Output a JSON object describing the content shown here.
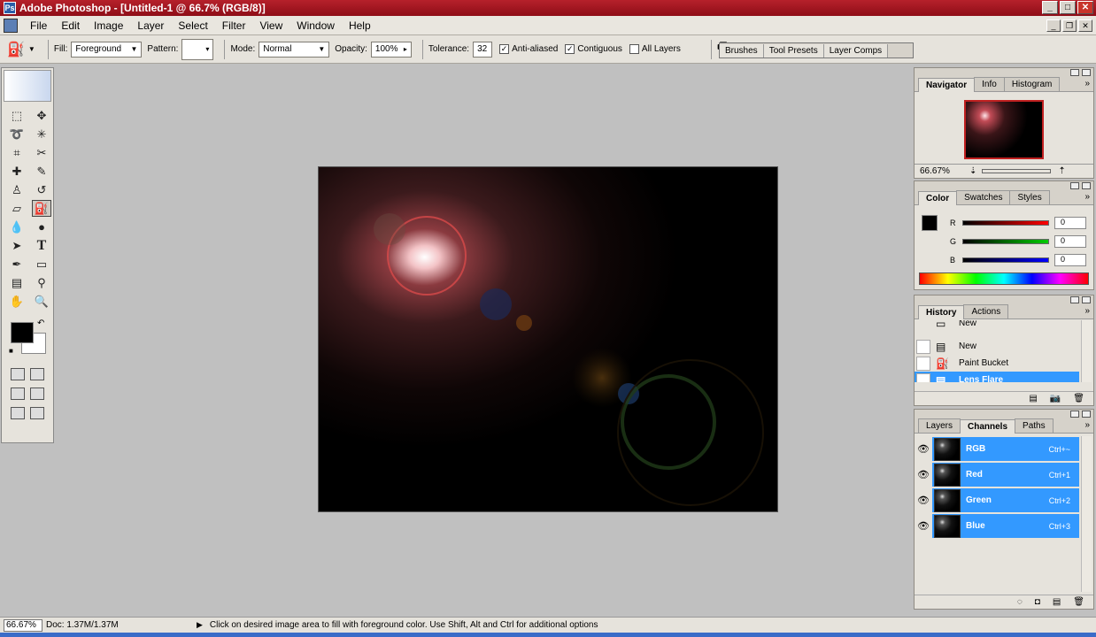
{
  "window": {
    "title": "Adobe Photoshop - [Untitled-1 @ 66.7% (RGB/8)]",
    "minimize": "_",
    "maximize": "□",
    "close": "✕"
  },
  "menu": [
    "File",
    "Edit",
    "Image",
    "Layer",
    "Select",
    "Filter",
    "View",
    "Window",
    "Help"
  ],
  "options": {
    "fill_label": "Fill:",
    "fill_value": "Foreground",
    "pattern_label": "Pattern:",
    "mode_label": "Mode:",
    "mode_value": "Normal",
    "opacity_label": "Opacity:",
    "opacity_value": "100%",
    "tolerance_label": "Tolerance:",
    "tolerance_value": "32",
    "anti_aliased": {
      "label": "Anti-aliased",
      "checked": true
    },
    "contiguous": {
      "label": "Contiguous",
      "checked": true
    },
    "all_layers": {
      "label": "All Layers",
      "checked": false
    }
  },
  "palette_well": [
    "Brushes",
    "Tool Presets",
    "Layer Comps"
  ],
  "navigator": {
    "tabs": [
      "Navigator",
      "Info",
      "Histogram"
    ],
    "zoom": "66.67%"
  },
  "color": {
    "tabs": [
      "Color",
      "Swatches",
      "Styles"
    ],
    "channels": [
      {
        "label": "R",
        "value": "0"
      },
      {
        "label": "G",
        "value": "0"
      },
      {
        "label": "B",
        "value": "0"
      }
    ]
  },
  "history": {
    "tabs": [
      "History",
      "Actions"
    ],
    "top_item": "New",
    "items": [
      {
        "label": "New",
        "icon": "document-icon"
      },
      {
        "label": "Paint Bucket",
        "icon": "paint-bucket-icon"
      },
      {
        "label": "Lens Flare",
        "icon": "document-icon",
        "active": true
      }
    ]
  },
  "channels": {
    "tabs": [
      "Layers",
      "Channels",
      "Paths"
    ],
    "rows": [
      {
        "name": "RGB",
        "shortcut": "Ctrl+~"
      },
      {
        "name": "Red",
        "shortcut": "Ctrl+1"
      },
      {
        "name": "Green",
        "shortcut": "Ctrl+2"
      },
      {
        "name": "Blue",
        "shortcut": "Ctrl+3"
      }
    ]
  },
  "status": {
    "zoom": "66.67%",
    "doc": "Doc: 1.37M/1.37M",
    "hint": "Click on desired image area to fill with foreground color.  Use Shift, Alt and Ctrl for additional options"
  }
}
